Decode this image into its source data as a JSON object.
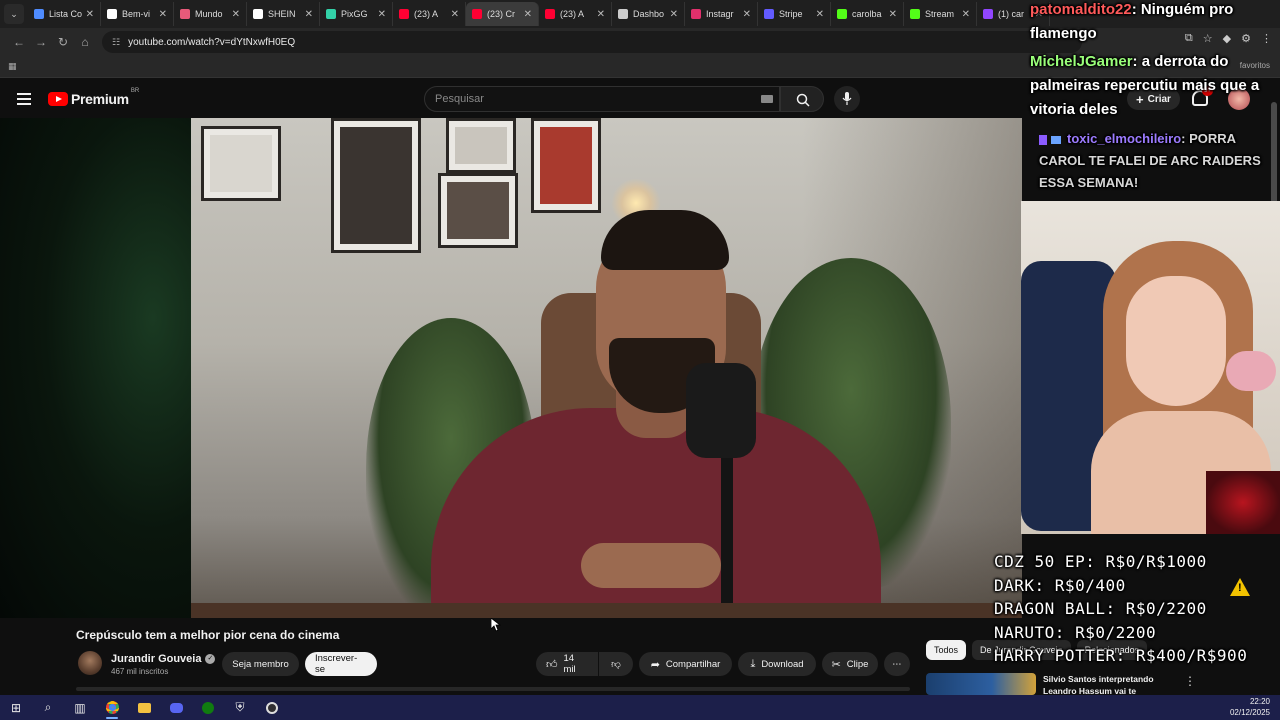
{
  "browser": {
    "tabs": [
      {
        "label": "Lista Co",
        "color": "#4f8cff"
      },
      {
        "label": "Bem-vi",
        "color": "#ffffff"
      },
      {
        "label": "Mundo",
        "color": "#e85a7a"
      },
      {
        "label": "SHEIN",
        "color": "#ffffff"
      },
      {
        "label": "PixGG",
        "color": "#33d1a8"
      },
      {
        "label": "(23) A",
        "color": "#ff0033"
      },
      {
        "label": "(23) Cr",
        "color": "#ff0033"
      },
      {
        "label": "(23) A",
        "color": "#ff0033"
      },
      {
        "label": "Dashbo",
        "color": "#cccccc"
      },
      {
        "label": "Instagr",
        "color": "#e1306c"
      },
      {
        "label": "Stripe",
        "color": "#635bff"
      },
      {
        "label": "carolba",
        "color": "#53fc18"
      },
      {
        "label": "Stream",
        "color": "#53fc18"
      },
      {
        "label": "(1) car",
        "color": "#9146ff"
      }
    ],
    "active_tab": 6,
    "url": "youtube.com/watch?v=dYtNxwfH0EQ",
    "bookmarks_label": "favoritos"
  },
  "youtube": {
    "brand": "Premium",
    "country": "BR",
    "search_placeholder": "Pesquisar",
    "create_label": "Criar",
    "notifications_count": "9+",
    "video": {
      "title": "Crepúsculo tem a melhor pior cena do cinema",
      "channel": "Jurandir Gouveia",
      "subscribers": "467 mil inscritos",
      "join_label": "Seja membro",
      "subscribe_label": "Inscrever-se",
      "likes": "14 mil",
      "share_label": "Compartilhar",
      "download_label": "Download",
      "clip_label": "Clipe"
    },
    "filters": [
      "Todos",
      "De Jurandir Gouveia",
      "Relacionados"
    ],
    "recommendation": {
      "title": "Silvio Santos interpretando Leandro Hassum vai te"
    }
  },
  "stream_overlay": {
    "chat": [
      {
        "user": "patomaldito22",
        "message": ": Ninguém pro flamengo"
      },
      {
        "user": "MichelJGamer",
        "message": ": a derrota do palmeiras repercutiu mais que a vitoria deles"
      },
      {
        "user": "toxic_elmochileiro",
        "message": ": PORRA CAROL TE FALEI DE ARC RAIDERS ESSA SEMANA!"
      }
    ],
    "goals": [
      "CDZ 50 EP: R$0/R$1000",
      "DARK: R$0/400",
      "DRAGON BALL: R$0/2200",
      "NARUTO: R$0/2200",
      "HARRY POTTER: R$400/R$900"
    ]
  },
  "taskbar": {
    "time": "22:20",
    "date": "02/12/2025"
  }
}
